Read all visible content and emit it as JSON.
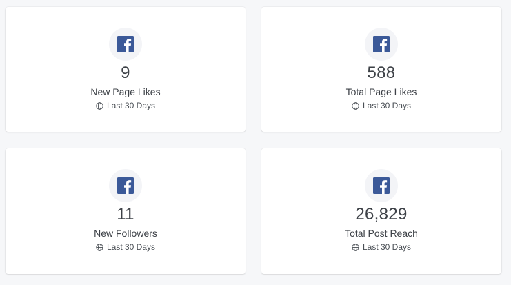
{
  "brand": {
    "facebook_color": "#3b5998"
  },
  "cards": [
    {
      "icon": "facebook-icon",
      "value": "9",
      "label": "New Page Likes",
      "period_icon": "globe-icon",
      "period": "Last 30 Days"
    },
    {
      "icon": "facebook-icon",
      "value": "588",
      "label": "Total Page Likes",
      "period_icon": "globe-icon",
      "period": "Last 30 Days"
    },
    {
      "icon": "facebook-icon",
      "value": "11",
      "label": "New Followers",
      "period_icon": "globe-icon",
      "period": "Last 30 Days"
    },
    {
      "icon": "facebook-icon",
      "value": "26,829",
      "label": "Total Post Reach",
      "period_icon": "globe-icon",
      "period": "Last 30 Days"
    }
  ]
}
